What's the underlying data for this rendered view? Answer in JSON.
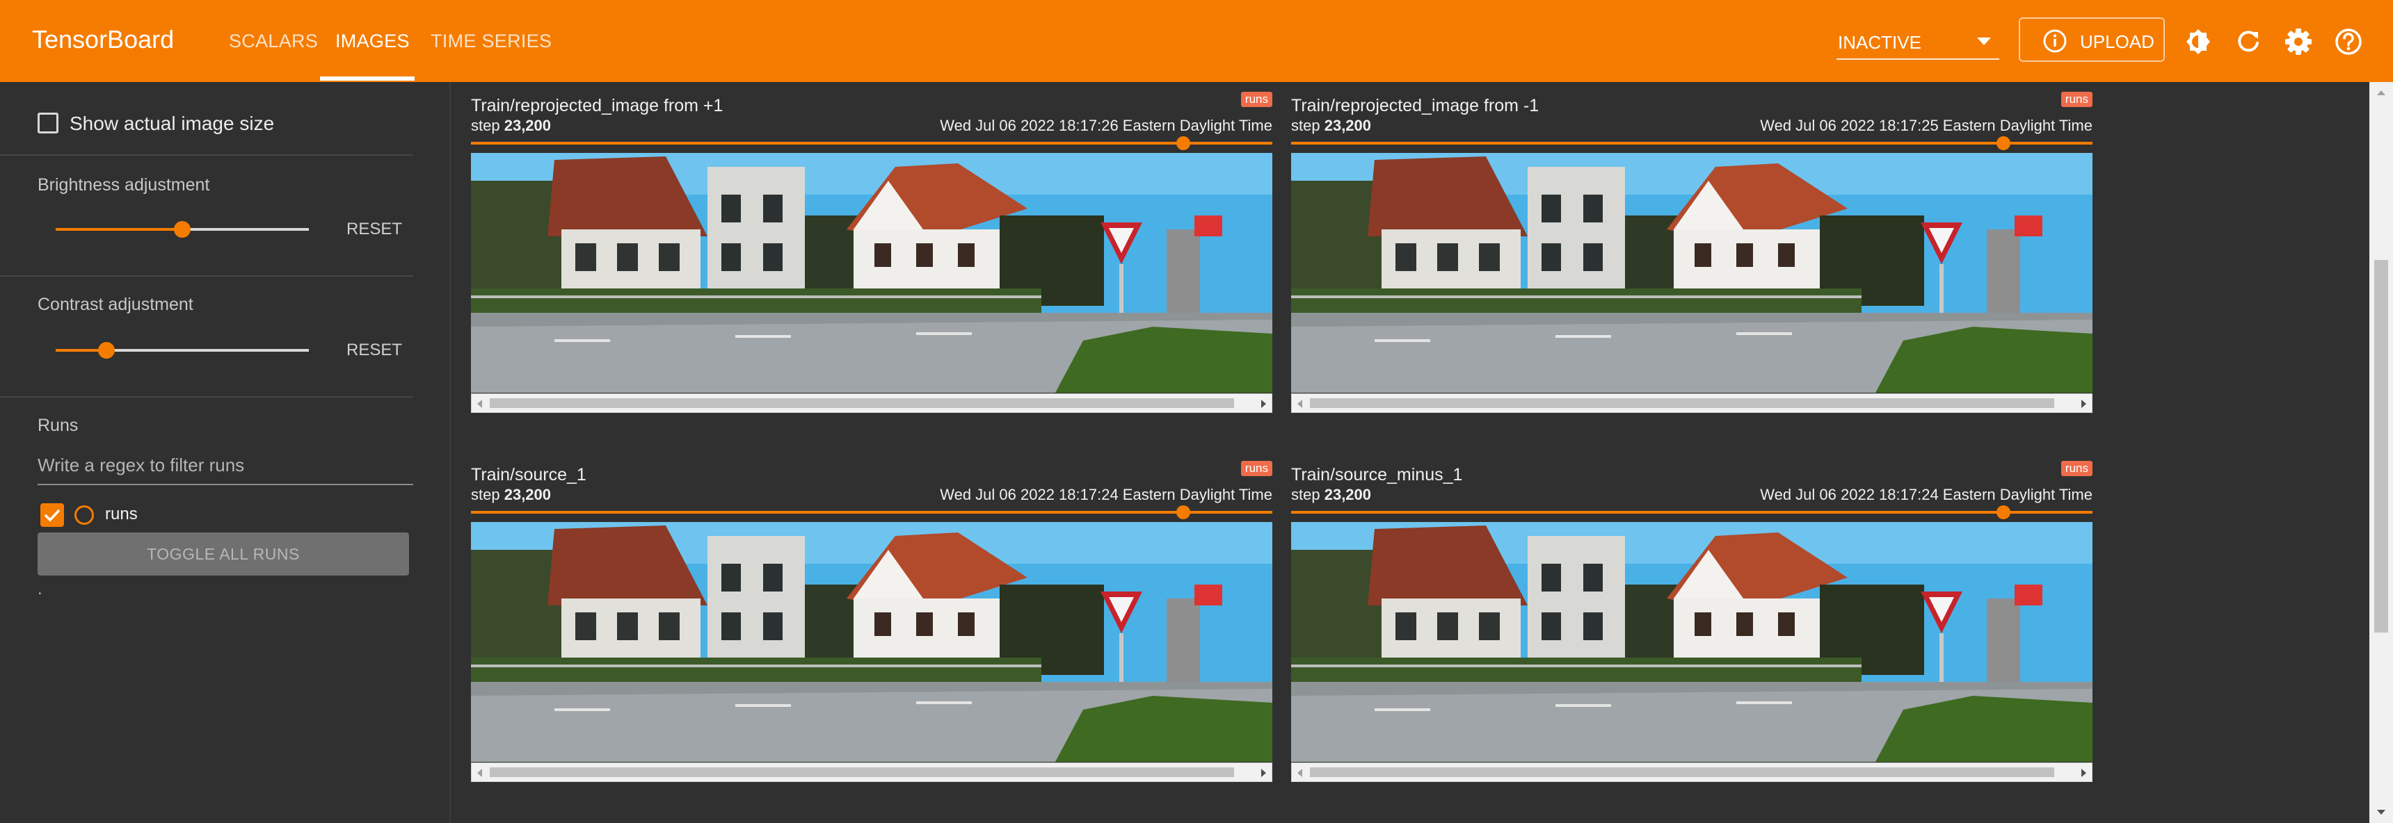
{
  "app": {
    "title": "TensorBoard"
  },
  "nav": {
    "tabs": [
      {
        "label": "SCALARS"
      },
      {
        "label": "IMAGES"
      },
      {
        "label": "TIME SERIES"
      }
    ],
    "active_tab": "IMAGES"
  },
  "toolbar": {
    "run_state": "INACTIVE",
    "upload_label": "UPLOAD",
    "icons": [
      "info-icon",
      "brightness-icon",
      "refresh-icon",
      "settings-icon",
      "help-icon"
    ]
  },
  "sidebar": {
    "show_actual_size_label": "Show actual image size",
    "show_actual_size_checked": false,
    "brightness": {
      "title": "Brightness adjustment",
      "reset_label": "RESET",
      "level": 0.5
    },
    "contrast": {
      "title": "Contrast adjustment",
      "reset_label": "RESET",
      "level": 0.2
    },
    "runs": {
      "title": "Runs",
      "filter_placeholder": "Write a regex to filter runs",
      "items": [
        {
          "label": "runs",
          "checked": true,
          "color": "#f57c00"
        }
      ],
      "toggle_all_label": "TOGGLE ALL RUNS",
      "footnote": "."
    }
  },
  "cards": [
    {
      "title": "Train/reprojected_image from +1",
      "step_label": "step",
      "step": "23,200",
      "timestamp": "Wed Jul 06 2022 18:17:26 Eastern Daylight Time",
      "badge": "runs",
      "step_slider": 0.889
    },
    {
      "title": "Train/reprojected_image from -1",
      "step_label": "step",
      "step": "23,200",
      "timestamp": "Wed Jul 06 2022 18:17:25 Eastern Daylight Time",
      "badge": "runs",
      "step_slider": 0.889
    },
    {
      "title": "Train/source_1",
      "step_label": "step",
      "step": "23,200",
      "timestamp": "Wed Jul 06 2022 18:17:24 Eastern Daylight Time",
      "badge": "runs",
      "step_slider": 0.889
    },
    {
      "title": "Train/source_minus_1",
      "step_label": "step",
      "step": "23,200",
      "timestamp": "Wed Jul 06 2022 18:17:24 Eastern Daylight Time",
      "badge": "runs",
      "step_slider": 0.889
    }
  ],
  "colors": {
    "accent": "#f57c00",
    "background": "#303030",
    "badge": "#ef6c4a"
  }
}
